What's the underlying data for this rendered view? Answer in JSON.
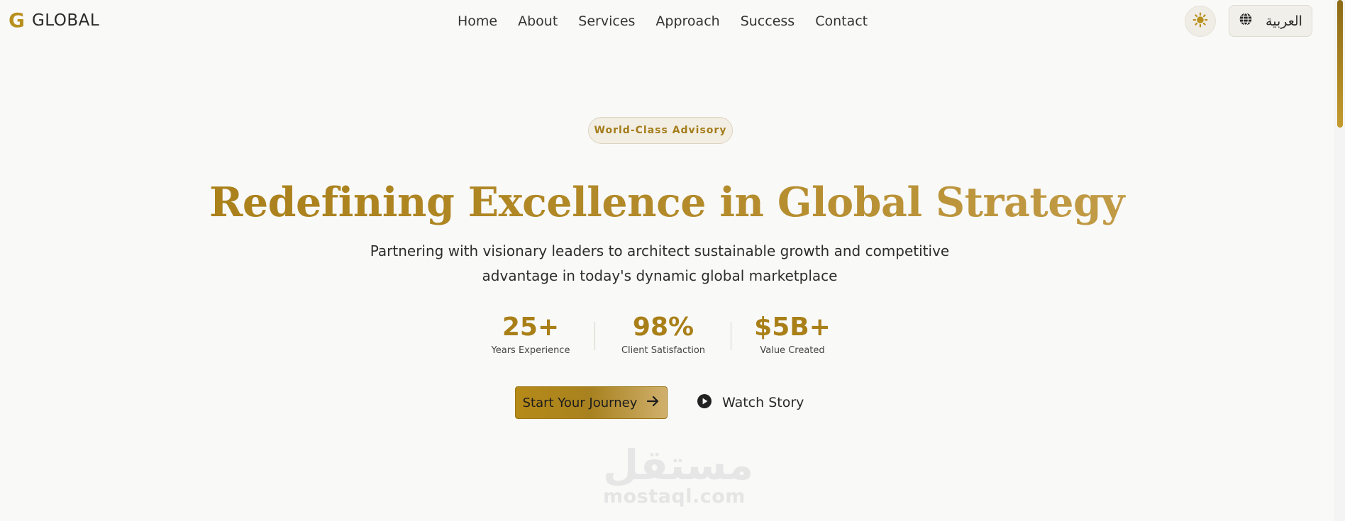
{
  "header": {
    "logo_mark": "G",
    "logo_text": "GLOBAL",
    "nav": [
      "Home",
      "About",
      "Services",
      "Approach",
      "Success",
      "Contact"
    ],
    "theme_icon": "sun-icon",
    "language": {
      "icon": "globe-icon",
      "label": "العربية"
    }
  },
  "hero": {
    "badge": "World-Class Advisory",
    "title": "Redefining Excellence in Global Strategy",
    "subtitle_line1": "Partnering with visionary leaders to architect sustainable growth and competitive",
    "subtitle_line2": "advantage in today's dynamic global marketplace",
    "stats": [
      {
        "value": "25+",
        "label": "Years Experience"
      },
      {
        "value": "98%",
        "label": "Client Satisfaction"
      },
      {
        "value": "$5B+",
        "label": "Value Created"
      }
    ],
    "primary_cta": {
      "label": "Start Your Journey",
      "icon": "arrow-right-icon"
    },
    "secondary_cta": {
      "label": "Watch Story",
      "icon": "play-circle-icon"
    }
  },
  "watermark": {
    "arabic": "مستقل",
    "latin": "mostaql.com"
  },
  "colors": {
    "accent": "#b8901f",
    "background": "#f9f9f8",
    "text": "#2a2a2a"
  }
}
